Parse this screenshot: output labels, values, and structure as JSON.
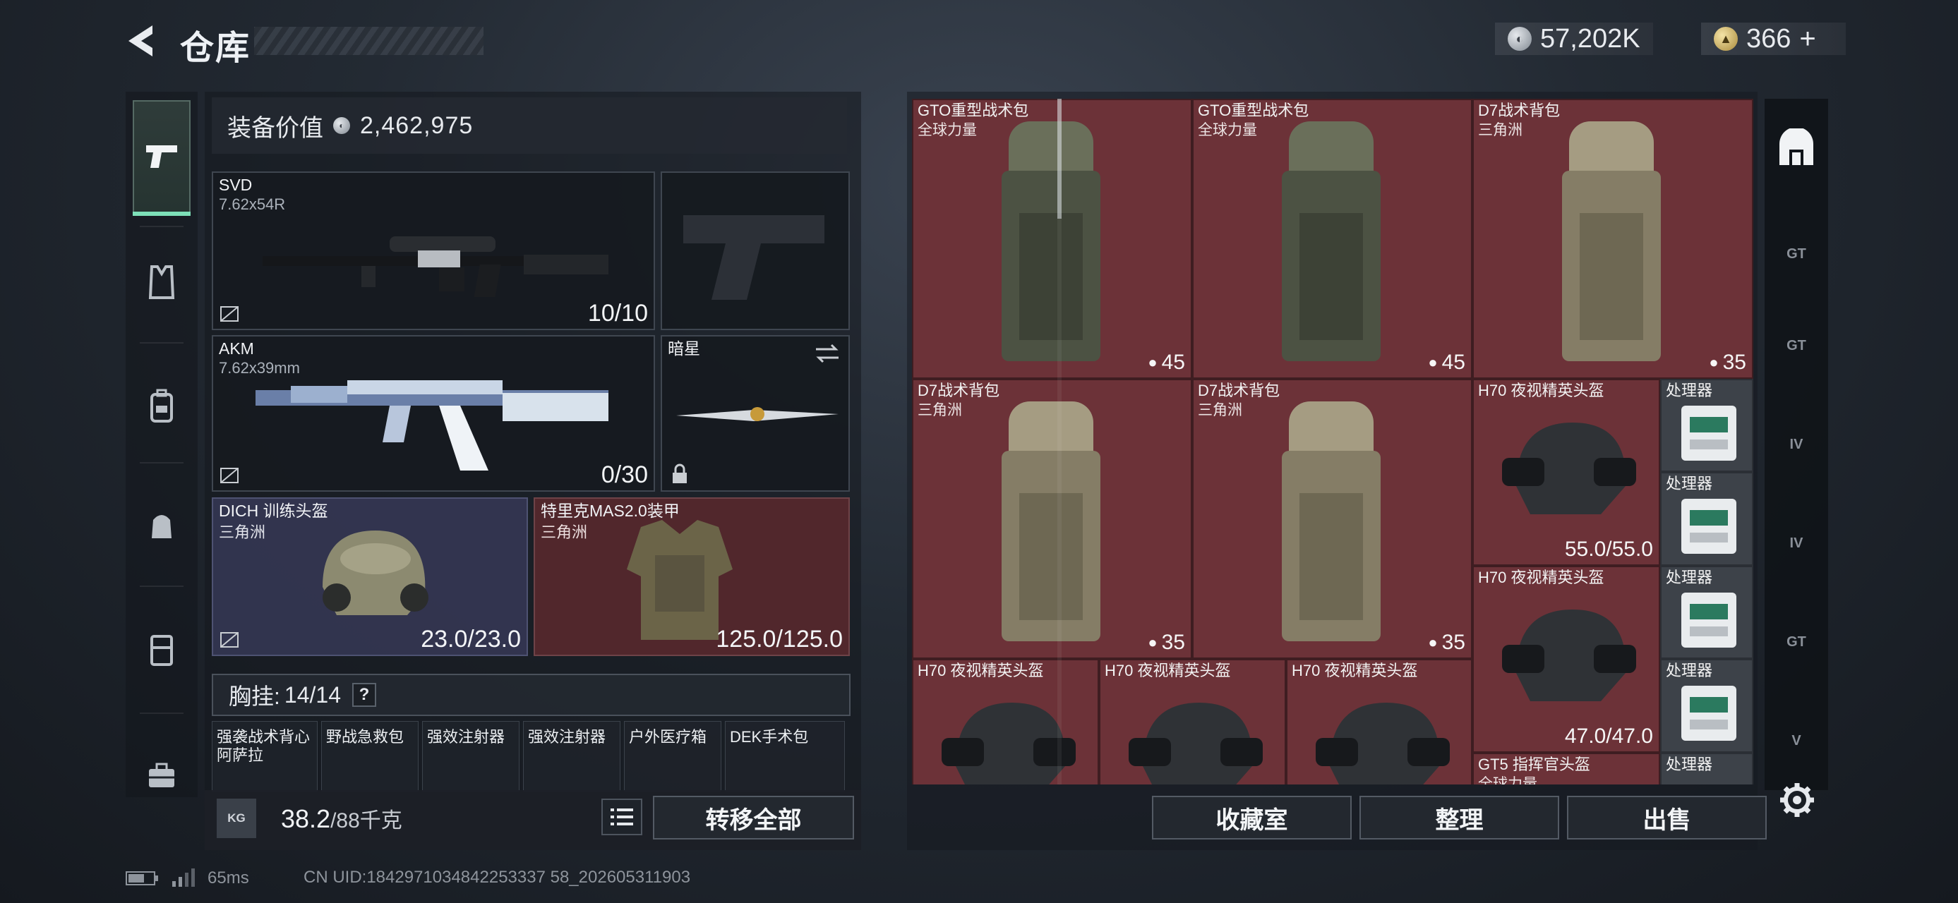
{
  "header": {
    "title": "仓库",
    "currency_silver": "57,202K",
    "currency_gold": "366",
    "currency_gold_add": "+"
  },
  "equipment": {
    "value_label": "装备价值",
    "value": "2,462,975",
    "primary_weapon": {
      "name": "SVD",
      "caliber": "7.62x54R",
      "ammo": "10/10"
    },
    "secondary_weapon": {
      "name": "AKM",
      "caliber": "7.62x39mm",
      "ammo": "0/30"
    },
    "melee": {
      "name": "暗星"
    },
    "helmet": {
      "name": "DICH 训练头盔",
      "map": "三角洲",
      "durability": "23.0/23.0"
    },
    "armor": {
      "name": "特里克MAS2.0装甲",
      "map": "三角洲",
      "durability": "125.0/125.0"
    },
    "chest_rig": {
      "label": "胸挂:",
      "slots": "14/14",
      "help": "?"
    },
    "rig_items": [
      {
        "name": "强袭战术背心",
        "sub": "阿萨拉"
      },
      {
        "name": "野战急救包"
      },
      {
        "name": "强效注射器"
      },
      {
        "name": "强效注射器"
      },
      {
        "name": "户外医疗箱"
      },
      {
        "name": "DEK手术包"
      }
    ],
    "weight": {
      "current": "38.2",
      "max": "/88千克"
    },
    "kg_icon": "KG",
    "transfer_all": "转移全部"
  },
  "storage": {
    "items": [
      {
        "name": "GTO重型战术包",
        "sub": "全球力量",
        "capacity": "45"
      },
      {
        "name": "GTO重型战术包",
        "sub": "全球力量",
        "capacity": "45"
      },
      {
        "name": "D7战术背包",
        "sub": "三角洲",
        "capacity": "35"
      },
      {
        "name": "D7战术背包",
        "sub": "三角洲",
        "capacity": "35"
      },
      {
        "name": "D7战术背包",
        "sub": "三角洲",
        "capacity": "35"
      },
      {
        "name": "H70 夜视精英头盔",
        "durability": "55.0/55.0"
      },
      {
        "name": "H70 夜视精英头盔",
        "durability": "47.0/47.0"
      },
      {
        "name": "H70 夜视精英头盔"
      },
      {
        "name": "H70 夜视精英头盔"
      },
      {
        "name": "H70 夜视精英头盔"
      },
      {
        "name": "GT5 指挥官头盔",
        "sub": "全球力量"
      }
    ],
    "processors": [
      "处理器",
      "处理器",
      "处理器",
      "处理器",
      "处理器"
    ],
    "actions": {
      "collection": "收藏室",
      "organize": "整理",
      "sell": "出售"
    },
    "tabs": [
      "",
      "GT",
      "GT",
      "IV",
      "IV",
      "GT",
      "V"
    ]
  },
  "status": {
    "ping": "65ms",
    "uid": "CN UID:1842971034842253337 58_202605311903"
  },
  "colors": {
    "rare_red": "#6c3238",
    "epic_purple": "#34365a",
    "accent_green": "#7de0b8",
    "panel": "#1c2128"
  }
}
